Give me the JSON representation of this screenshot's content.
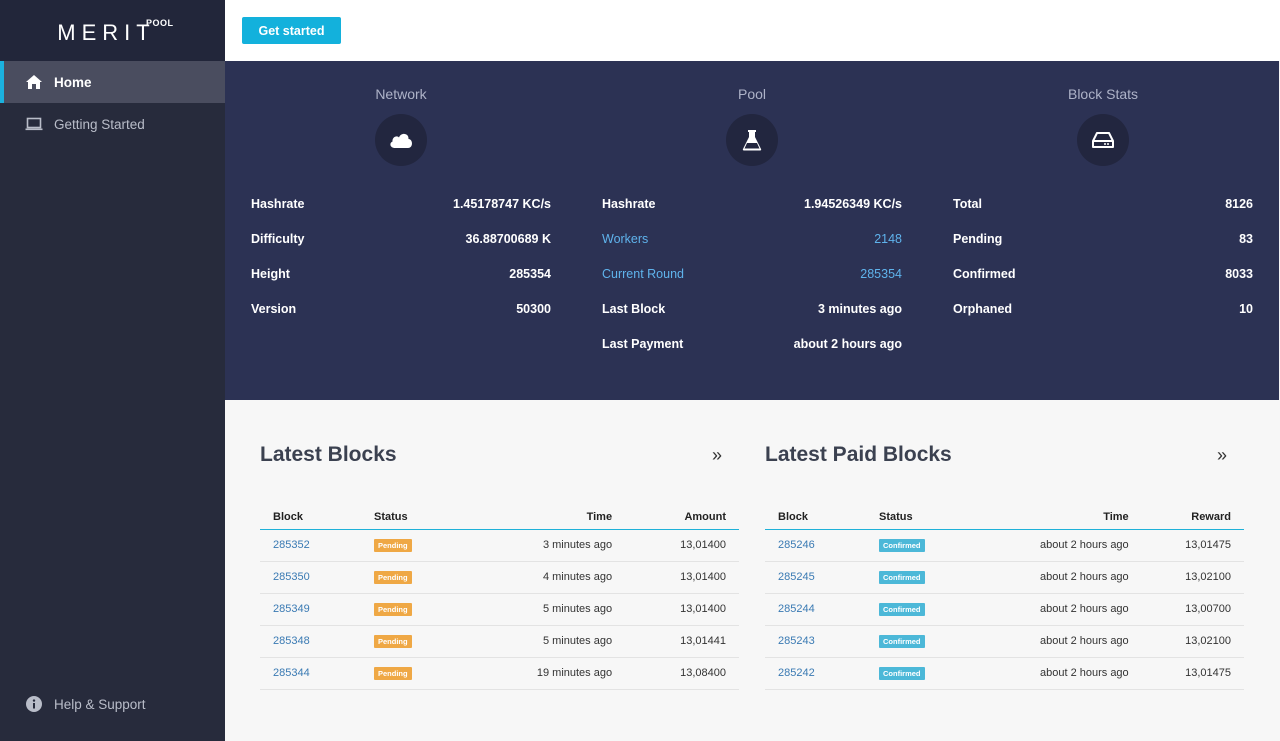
{
  "sidebar": {
    "logo": "MERIT",
    "logo_sup": "POOL",
    "items": [
      {
        "label": "Home",
        "icon": "home-icon"
      },
      {
        "label": "Getting Started",
        "icon": "laptop-icon"
      }
    ],
    "help": {
      "label": "Help & Support",
      "icon": "info-icon"
    }
  },
  "topbar": {
    "get_started": "Get started"
  },
  "stats": {
    "network": {
      "title": "Network",
      "icon": "cloud-icon",
      "rows": [
        {
          "label": "Hashrate",
          "value": "1.45178747 KC/s"
        },
        {
          "label": "Difficulty",
          "value": "36.88700689 K"
        },
        {
          "label": "Height",
          "value": "285354"
        },
        {
          "label": "Version",
          "value": "50300"
        }
      ]
    },
    "pool": {
      "title": "Pool",
      "icon": "flask-icon",
      "rows": [
        {
          "label": "Hashrate",
          "value": "1.94526349 KC/s"
        },
        {
          "label": "Workers",
          "value": "2148"
        },
        {
          "label": "Current Round",
          "value": "285354"
        },
        {
          "label": "Last Block",
          "value": "3 minutes ago"
        },
        {
          "label": "Last Payment",
          "value": "about 2 hours ago"
        }
      ]
    },
    "blocks": {
      "title": "Block Stats",
      "icon": "drive-icon",
      "rows": [
        {
          "label": "Total",
          "value": "8126"
        },
        {
          "label": "Pending",
          "value": "83"
        },
        {
          "label": "Confirmed",
          "value": "8033"
        },
        {
          "label": "Orphaned",
          "value": "10"
        }
      ]
    }
  },
  "latest_blocks": {
    "title": "Latest Blocks",
    "more": "»",
    "columns": [
      "Block",
      "Status",
      "Time",
      "Amount"
    ],
    "rows": [
      {
        "block": "285352",
        "status": "Pending",
        "time": "3 minutes ago",
        "amount": "13,01400"
      },
      {
        "block": "285350",
        "status": "Pending",
        "time": "4 minutes ago",
        "amount": "13,01400"
      },
      {
        "block": "285349",
        "status": "Pending",
        "time": "5 minutes ago",
        "amount": "13,01400"
      },
      {
        "block": "285348",
        "status": "Pending",
        "time": "5 minutes ago",
        "amount": "13,01441"
      },
      {
        "block": "285344",
        "status": "Pending",
        "time": "19 minutes ago",
        "amount": "13,08400"
      }
    ]
  },
  "latest_paid_blocks": {
    "title": "Latest Paid Blocks",
    "more": "»",
    "columns": [
      "Block",
      "Status",
      "Time",
      "Reward"
    ],
    "rows": [
      {
        "block": "285246",
        "status": "Confirmed",
        "time": "about 2 hours ago",
        "amount": "13,01475"
      },
      {
        "block": "285245",
        "status": "Confirmed",
        "time": "about 2 hours ago",
        "amount": "13,02100"
      },
      {
        "block": "285244",
        "status": "Confirmed",
        "time": "about 2 hours ago",
        "amount": "13,00700"
      },
      {
        "block": "285243",
        "status": "Confirmed",
        "time": "about 2 hours ago",
        "amount": "13,02100"
      },
      {
        "block": "285242",
        "status": "Confirmed",
        "time": "about 2 hours ago",
        "amount": "13,01475"
      }
    ]
  },
  "colors": {
    "sidebar": "#272b3c",
    "stats_bg": "#2c3254",
    "accent": "#13b1dc",
    "pending": "#efa845",
    "confirmed": "#4cb8d8",
    "link": "#5fb3ec"
  }
}
